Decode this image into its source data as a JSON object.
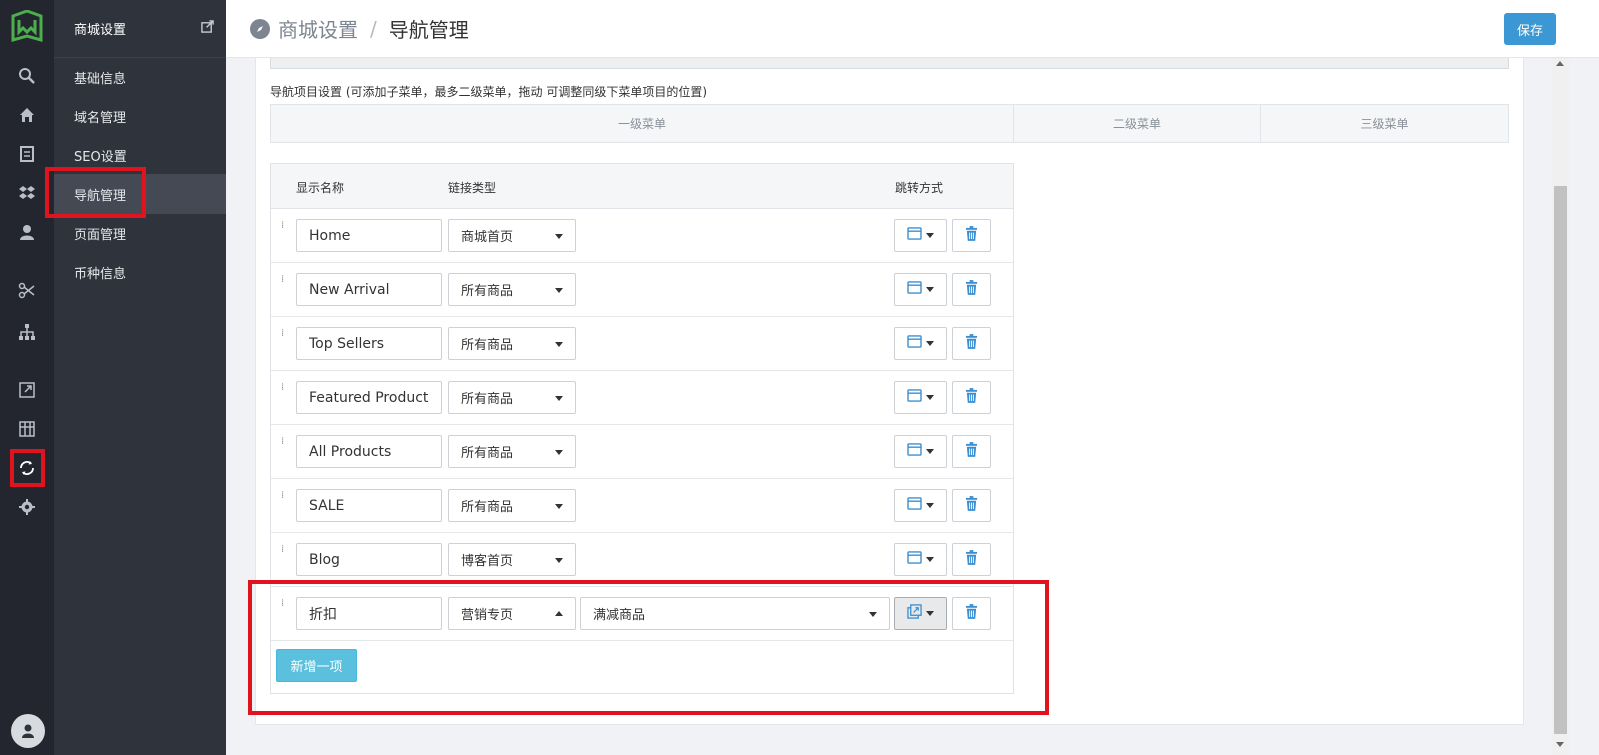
{
  "rail": {
    "icons": [
      "logo-icon",
      "search-icon",
      "home-icon",
      "orders-icon",
      "products-icon",
      "customers-icon",
      "marketing-icon",
      "sitemap-icon",
      "external-icon",
      "grid-icon",
      "refresh-icon",
      "settings-icon",
      "user-avatar-icon"
    ]
  },
  "sidebar": {
    "title": "商城设置",
    "items": [
      {
        "label": "基础信息"
      },
      {
        "label": "域名管理"
      },
      {
        "label": "SEO设置"
      },
      {
        "label": "导航管理"
      },
      {
        "label": "页面管理"
      },
      {
        "label": "币种信息"
      }
    ],
    "active_index": 3
  },
  "header": {
    "crumb_parent": "商城设置",
    "crumb_sep": "/",
    "crumb_current": "导航管理",
    "save_label": "保存"
  },
  "main": {
    "hint": "导航项目设置 (可添加子菜单，最多二级菜单，拖动 可调整同级下菜单项目的位置)",
    "levels": [
      "一级菜单",
      "二级菜单",
      "三级菜单"
    ],
    "columns": {
      "name": "显示名称",
      "link_type": "链接类型",
      "jump": "跳转方式"
    },
    "rows": [
      {
        "name": "Home",
        "link": "商城首页"
      },
      {
        "name": "New Arrival",
        "link": "所有商品"
      },
      {
        "name": "Top Sellers",
        "link": "所有商品"
      },
      {
        "name": "Featured Products",
        "link": "所有商品"
      },
      {
        "name": "All Products",
        "link": "所有商品"
      },
      {
        "name": "SALE",
        "link": "所有商品"
      },
      {
        "name": "Blog",
        "link": "博客首页"
      },
      {
        "name": "折扣",
        "link": "营销专页",
        "sub_link": "满减商品"
      }
    ],
    "add_label": "新增一项"
  },
  "colors": {
    "rail_bg": "#23262e",
    "sidebar_bg": "#2f333c",
    "accent": "#3b98d4",
    "add_button": "#5bc0de",
    "highlight": "#e0141e",
    "logo_green": "#4cae4c"
  }
}
